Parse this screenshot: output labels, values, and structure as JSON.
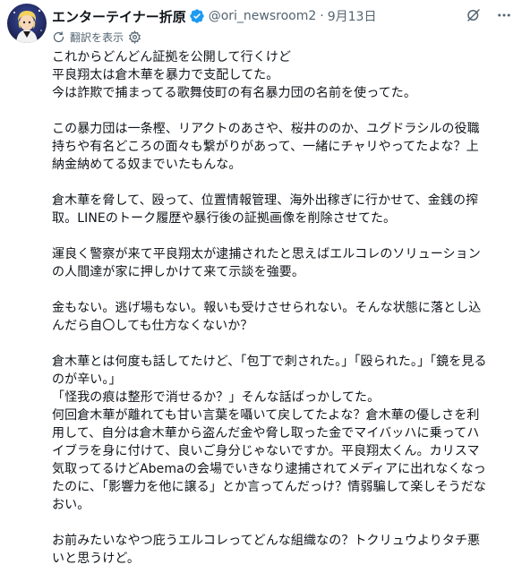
{
  "author": {
    "display_name": "エンターテイナー折原",
    "handle": "@ori_newsroom2",
    "separator": "·",
    "date": "9月13日"
  },
  "translate": {
    "label": "翻訳を表示"
  },
  "icons": {
    "avatar": "avatar-image",
    "verified": "verified-badge-icon",
    "grok": "grok-icon",
    "more": "more-options-icon",
    "translate": "translate-icon",
    "settings": "settings-gear-icon"
  },
  "colors": {
    "verified": "#1d9bf0",
    "text": "#0f1419",
    "secondary": "#536471"
  },
  "tweet_paragraphs": [
    [
      "これからどんどん証拠を公開して行くけど",
      "平良翔太は倉木華を暴力で支配してた。",
      "今は詐欺で捕まってる歌舞伎町の有名暴力団の名前を使ってた。"
    ],
    [
      "この暴力団は一条樫、リアクトのあさや、桜井ののか、ユグドラシルの役職",
      "持ちや有名どころの面々も繋がりがあって、一緒にチャリやってたよな？上",
      "納金納めてる奴までいたもんな。"
    ],
    [
      "倉木華を脅して、殴って、位置情報管理、海外出稼ぎに行かせて、金銭の搾",
      "取。LINEのトーク履歴や暴行後の証拠画像を削除させてた。"
    ],
    [
      "運良く警察が来て平良翔太が逮捕されたと思えばエルコレのソリューション",
      "の人間達が家に押しかけて来て示談を強要。"
    ],
    [
      "金もない。逃げ場もない。報いも受けさせられない。そんな状態に落とし込",
      "んだら自〇しても仕方なくないか？"
    ],
    [
      "倉木華とは何度も話してたけど、「包丁で刺された。」「殴られた。」「鏡を見る",
      "のが辛い。」",
      "「怪我の痕は整形で消せるか？」そんな話ばっかしてた。",
      "何回倉木華が離れても甘い言葉を囁いて戻してたよな？倉木華の優しさを利",
      "用して、自分は倉木華から盗んだ金や脅し取った金でマイバッハに乗ってハ",
      "イブラを身に付けて、良いご身分じゃないですか。平良翔太くん。カリスマ",
      "気取ってるけどAbemaの会場でいきなり逮捕されてメディアに出れなくなっ",
      "たのに、「影響力を他に譲る」とか言ってんだっけ？情弱騙して楽しそうだな",
      "おい。"
    ],
    [
      "お前みたいなやつ庇うエルコレってどんな組織なの？トクリュウよりタチ悪",
      "いと思うけど。"
    ]
  ]
}
